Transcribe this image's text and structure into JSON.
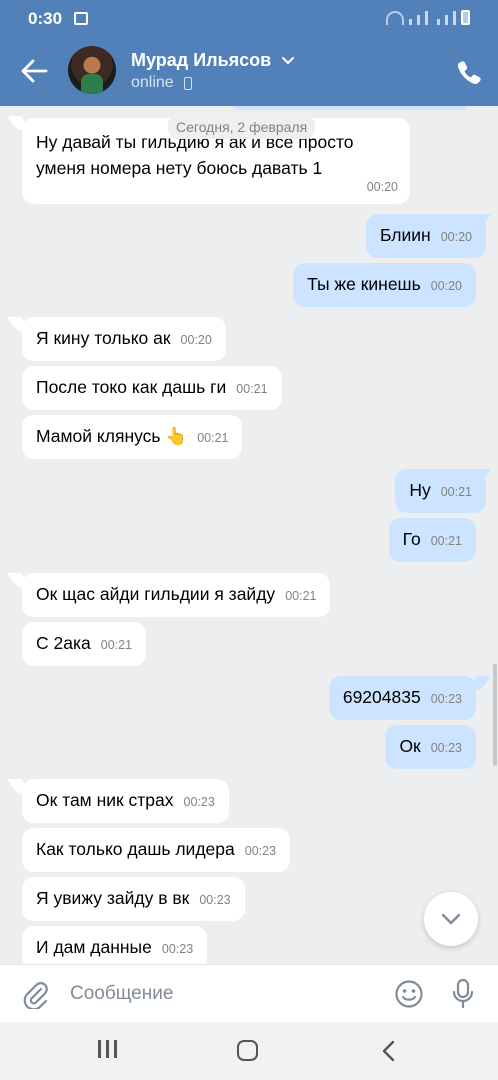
{
  "status_bar": {
    "time": "0:30"
  },
  "header": {
    "contact_name": "Мурад Ильясов",
    "status": "online"
  },
  "date_separator": "Сегодня, 2 февраля",
  "messages": [
    {
      "dir": "in",
      "text_line1": "Ну давай ты гильдию я ак и все просто",
      "text_line2": "уменя номера нету боюсь давать 1",
      "time": "00:20"
    },
    {
      "dir": "out",
      "text": "Блиин",
      "time": "00:20"
    },
    {
      "dir": "out",
      "text": "Ты же кинешь",
      "time": "00:20"
    },
    {
      "dir": "in",
      "text": "Я кину только ак",
      "time": "00:20"
    },
    {
      "dir": "in",
      "text": "После токо как дашь ги",
      "time": "00:21"
    },
    {
      "dir": "in",
      "text": "Мамой клянусь 👆",
      "time": "00:21"
    },
    {
      "dir": "out",
      "text": "Ну",
      "time": "00:21"
    },
    {
      "dir": "out",
      "text": "Го",
      "time": "00:21"
    },
    {
      "dir": "in",
      "text": "Ок щас айди гильдии я зайду",
      "time": "00:21"
    },
    {
      "dir": "in",
      "text": "С 2ака",
      "time": "00:21"
    },
    {
      "dir": "out",
      "text": "69204835",
      "time": "00:23"
    },
    {
      "dir": "out",
      "text": "Ок",
      "time": "00:23"
    },
    {
      "dir": "in",
      "text": "Ок там ник страх",
      "time": "00:23"
    },
    {
      "dir": "in",
      "text": "Как только дашь лидера",
      "time": "00:23"
    },
    {
      "dir": "in",
      "text": "Я увижу зайду в вк",
      "time": "00:23"
    },
    {
      "dir": "in",
      "text": "И дам данные",
      "time": "00:23"
    }
  ],
  "composer": {
    "placeholder": "Сообщение"
  },
  "colors": {
    "header": "#5181b8",
    "outgoing_bubble": "#cce4ff",
    "incoming_bubble": "#ffffff",
    "background": "#edeef0"
  }
}
